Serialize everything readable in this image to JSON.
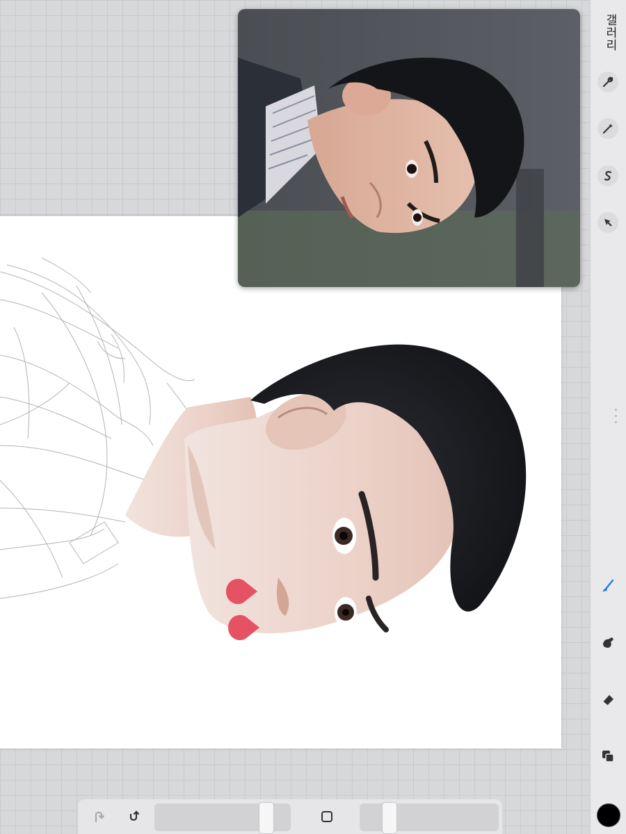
{
  "toolbar": {
    "gallery_label": "갤러리",
    "tools": [
      "wrench-icon",
      "magic-wand-icon",
      "selection-s-icon",
      "transform-arrow-icon"
    ],
    "paint_tools": [
      "brush-icon",
      "smudge-icon",
      "eraser-icon",
      "layers-icon"
    ],
    "active_tool": "brush-icon",
    "accent_color": "#1e7ce8",
    "current_color": "#000000"
  },
  "bottom": {
    "controls": [
      "undo-icon",
      "redo-icon",
      "square-modify-icon"
    ],
    "brush_size_level": 0.85,
    "opacity_level": 0.18
  }
}
